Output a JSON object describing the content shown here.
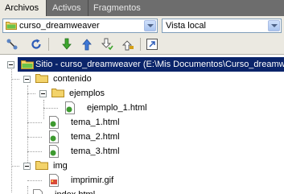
{
  "tabs": [
    {
      "label": "Archivos",
      "active": true
    },
    {
      "label": "Activos",
      "active": false
    },
    {
      "label": "Fragmentos",
      "active": false
    }
  ],
  "site_select": {
    "value": "curso_dreamweaver"
  },
  "view_select": {
    "value": "Vista local"
  },
  "toolbar": {
    "icons": [
      "connect-icon",
      "refresh-icon",
      "get-icon",
      "put-icon",
      "check-out-icon",
      "check-in-icon",
      "expand-icon"
    ]
  },
  "tree": {
    "root": "Sitio - curso_dreamweaver (E:\\Mis Documentos\\Curso_dreamwe",
    "items": [
      {
        "label": "contenido",
        "type": "folder"
      },
      {
        "label": "ejemplos",
        "type": "folder"
      },
      {
        "label": "ejemplo_1.html",
        "type": "html"
      },
      {
        "label": "tema_1.html",
        "type": "html"
      },
      {
        "label": "tema_2.html",
        "type": "html"
      },
      {
        "label": "tema_3.html",
        "type": "html"
      },
      {
        "label": "img",
        "type": "folder"
      },
      {
        "label": "imprimir.gif",
        "type": "gif"
      },
      {
        "label": "index.html",
        "type": "html"
      }
    ]
  },
  "colors": {
    "tab_bar": "#6d6d6d",
    "panel_bg": "#ebe9e1",
    "selection": "#0a246a",
    "folder": "#f3d36a",
    "html_icon": "#3d9a2f"
  }
}
